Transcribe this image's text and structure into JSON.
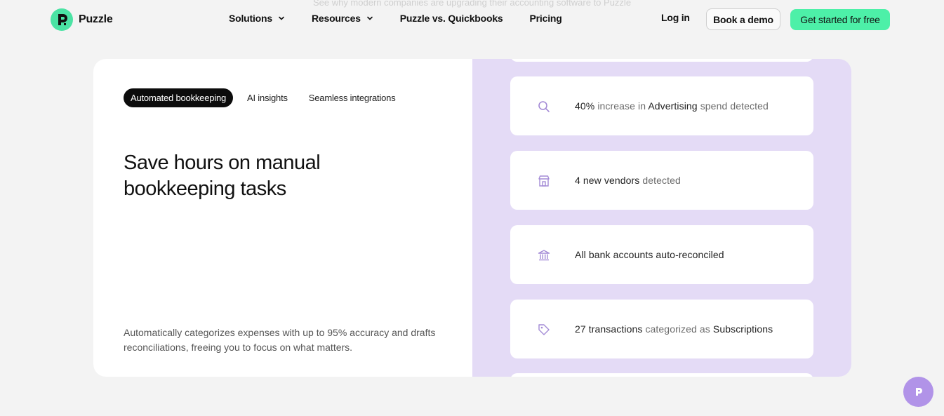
{
  "faded_banner": "See why modern companies are upgrading their accounting software to Puzzle",
  "brand": {
    "name": "Puzzle",
    "accent": "#4be3a4"
  },
  "nav": {
    "items": [
      {
        "label": "Solutions",
        "has_dropdown": true
      },
      {
        "label": "Resources",
        "has_dropdown": true
      },
      {
        "label": "Puzzle vs. Quickbooks",
        "has_dropdown": false
      },
      {
        "label": "Pricing",
        "has_dropdown": false
      }
    ],
    "login": "Log in",
    "demo": "Book a demo",
    "cta": "Get started for free"
  },
  "feature": {
    "tabs": [
      {
        "label": "Automated bookkeeping",
        "active": true
      },
      {
        "label": "AI insights",
        "active": false
      },
      {
        "label": "Seamless integrations",
        "active": false
      }
    ],
    "heading": "Save hours on manual bookkeeping tasks",
    "description": "Automatically categorizes expenses with up to 95% accuracy and drafts reconciliations, freeing you to focus on what matters."
  },
  "insights": [
    {
      "icon": "search-icon",
      "parts": [
        [
          "40%",
          false
        ],
        [
          " increase in ",
          true
        ],
        [
          "Advertising",
          false
        ],
        [
          " spend detected",
          true
        ]
      ]
    },
    {
      "icon": "store-icon",
      "parts": [
        [
          "4 new vendors",
          false
        ],
        [
          " detected",
          true
        ]
      ]
    },
    {
      "icon": "bank-icon",
      "parts": [
        [
          "All bank accounts auto-reconciled",
          false
        ]
      ]
    },
    {
      "icon": "tag-icon",
      "parts": [
        [
          "27 transactions",
          false
        ],
        [
          " categorized as ",
          true
        ],
        [
          "Subscriptions",
          false
        ]
      ]
    }
  ],
  "colors": {
    "panel": "#e4dbf6",
    "icon": "#a48bd6",
    "chat": "#b193e8",
    "cta": "#4df0a8"
  }
}
